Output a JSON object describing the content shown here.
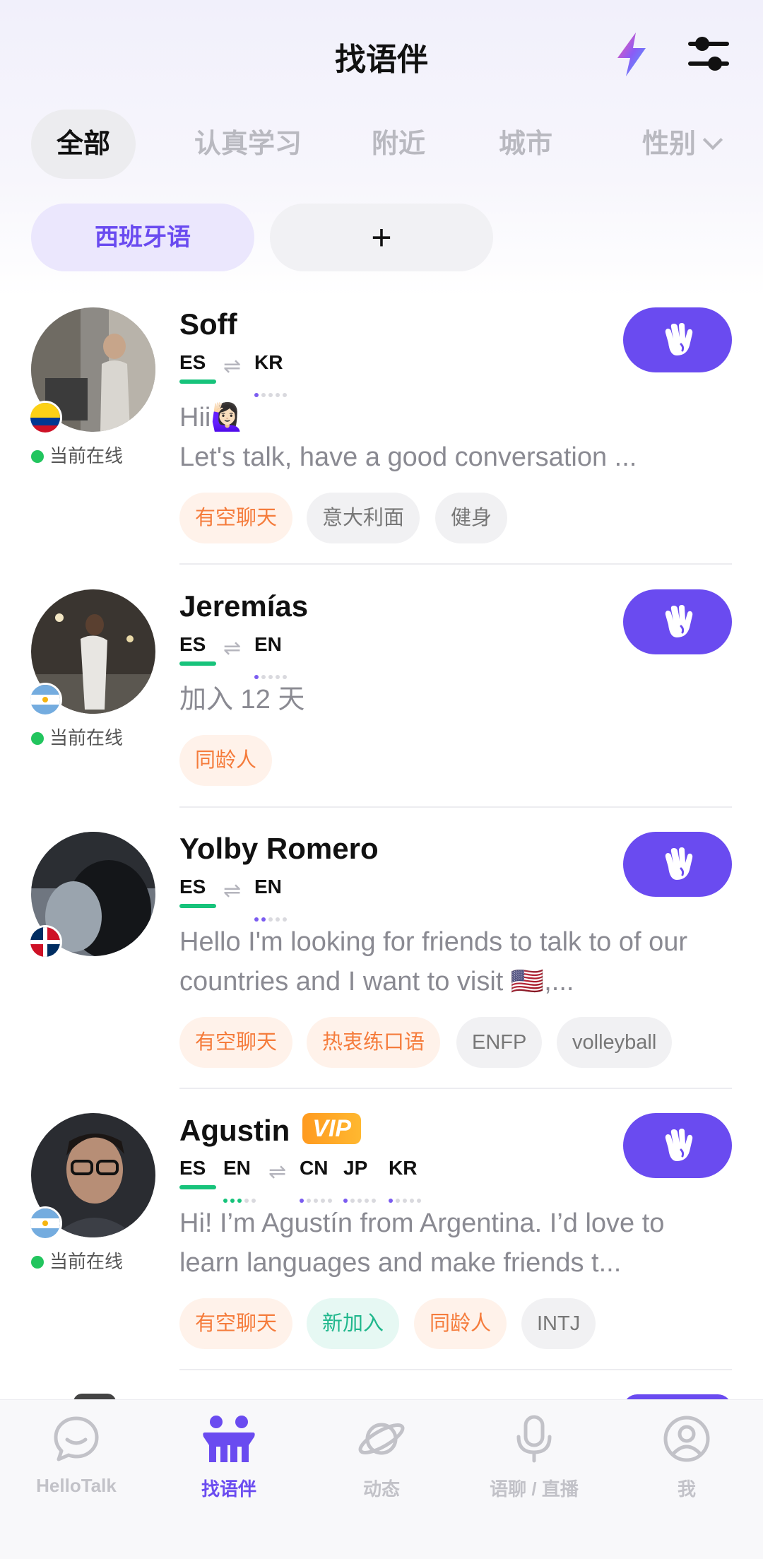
{
  "header": {
    "title": "找语伴"
  },
  "tabs": [
    {
      "label": "全部"
    },
    {
      "label": "认真学习"
    },
    {
      "label": "附近"
    },
    {
      "label": "城市"
    },
    {
      "label": "性别"
    }
  ],
  "language_filters": {
    "selected": "西班牙语",
    "add": "+"
  },
  "users": [
    {
      "name": "Soff",
      "status": "当前在线",
      "native": [
        "ES"
      ],
      "learning": [
        "KR"
      ],
      "bio": "Hii🙋🏻‍♀️\nLet's talk, have a good conversation ...",
      "tags": [
        "有空聊天",
        "意大利面",
        "健身"
      ]
    },
    {
      "name": "Jeremías",
      "status": "当前在线",
      "native": [
        "ES"
      ],
      "learning": [
        "EN"
      ],
      "bio": "加入 12 天",
      "tags": [
        "同龄人"
      ]
    },
    {
      "name": "Yolby Romero",
      "native": [
        "ES"
      ],
      "learning": [
        "EN"
      ],
      "bio": "Hello I'm looking for friends to talk to of our countries and I want to visit 🇺🇸,...",
      "tags": [
        "有空聊天",
        "热衷练口语",
        "ENFP",
        "volleyball"
      ]
    },
    {
      "name": "Agustin",
      "vip": "VIP",
      "status": "当前在线",
      "native": [
        "ES",
        "EN"
      ],
      "learning": [
        "CN",
        "JP",
        "KR"
      ],
      "bio": "Hi! I’m Agustín from Argentina. I’d love to learn languages and make friends t...",
      "tags": [
        "有空聊天",
        "新加入",
        "同龄人",
        "INTJ"
      ]
    }
  ],
  "bottom_nav": [
    {
      "label": "HelloTalk",
      "icon": "chat-bubble-icon"
    },
    {
      "label": "找语伴",
      "icon": "people-icon",
      "active": true
    },
    {
      "label": "动态",
      "icon": "planet-icon"
    },
    {
      "label": "语聊 / 直播",
      "icon": "microphone-icon"
    },
    {
      "label": "我",
      "icon": "profile-icon"
    }
  ],
  "colors": {
    "accent": "#6a4bf0",
    "native_bar": "#17c37b",
    "online": "#22c55e"
  }
}
